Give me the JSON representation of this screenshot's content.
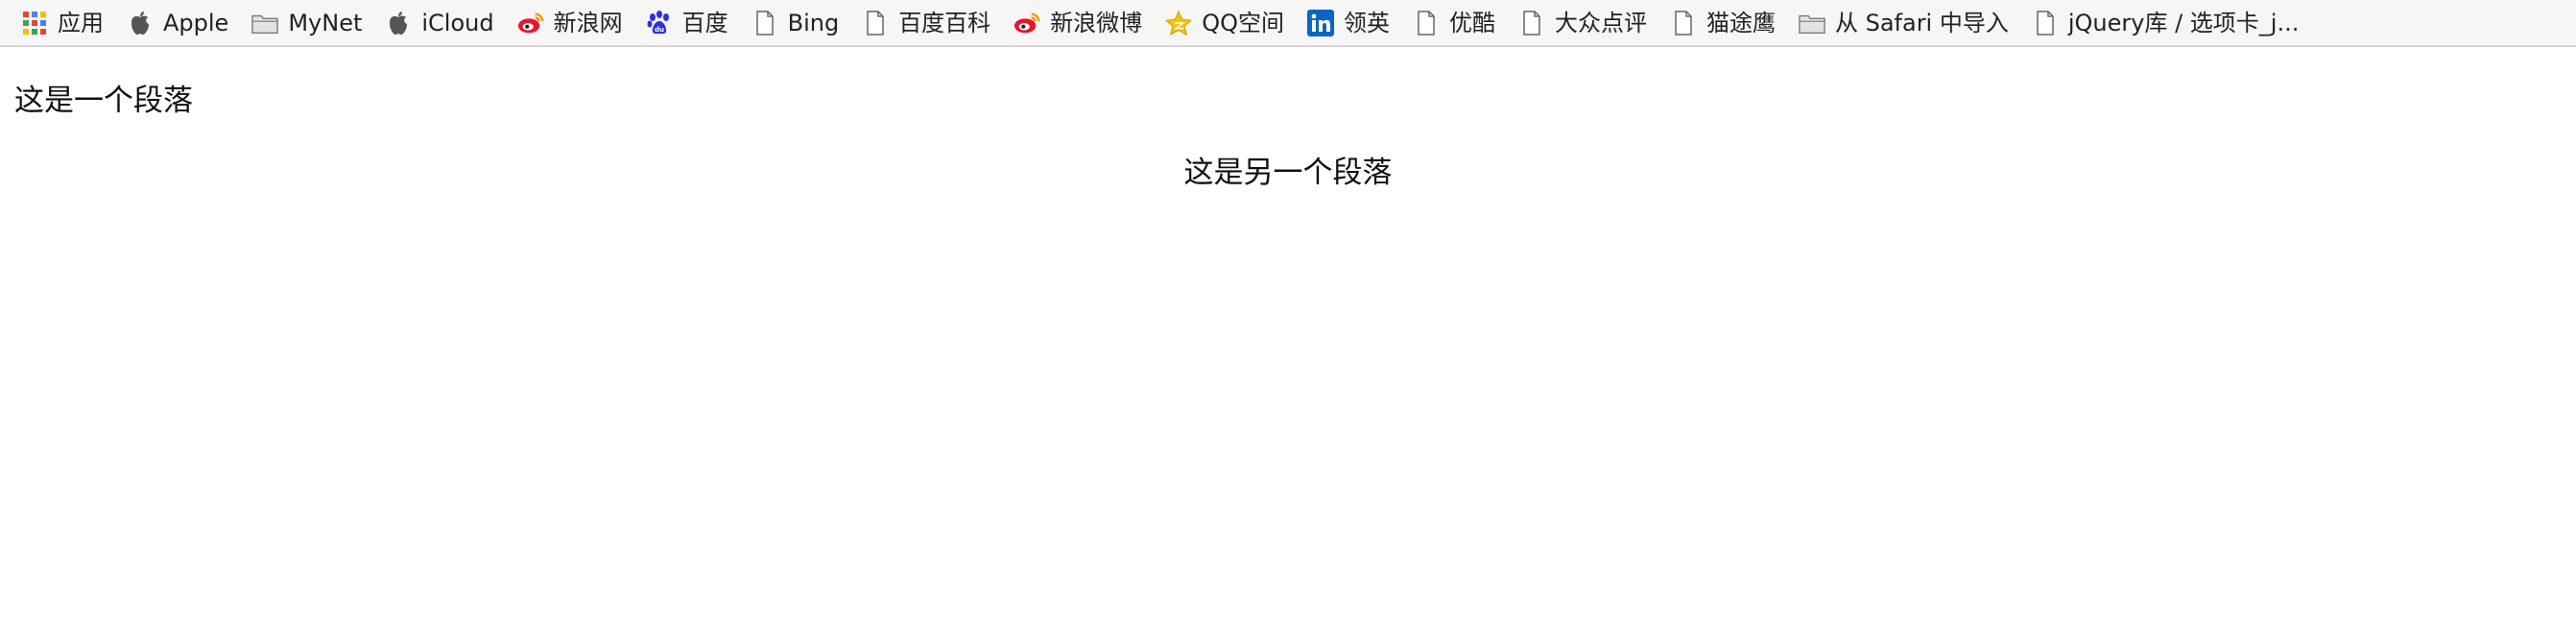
{
  "bookmarks": [
    {
      "label": "应用",
      "icon": "apps-grid-icon"
    },
    {
      "label": "Apple",
      "icon": "apple-icon"
    },
    {
      "label": "MyNet",
      "icon": "folder-icon"
    },
    {
      "label": "iCloud",
      "icon": "apple-icon"
    },
    {
      "label": "新浪网",
      "icon": "weibo-icon"
    },
    {
      "label": "百度",
      "icon": "baidu-paw-icon"
    },
    {
      "label": "Bing",
      "icon": "page-icon"
    },
    {
      "label": "百度百科",
      "icon": "page-icon"
    },
    {
      "label": "新浪微博",
      "icon": "weibo-icon"
    },
    {
      "label": "QQ空间",
      "icon": "star-icon"
    },
    {
      "label": "领英",
      "icon": "linkedin-icon"
    },
    {
      "label": "优酷",
      "icon": "page-icon"
    },
    {
      "label": "大众点评",
      "icon": "page-icon"
    },
    {
      "label": "猫途鹰",
      "icon": "page-icon"
    },
    {
      "label": "从 Safari 中导入",
      "icon": "folder-icon"
    },
    {
      "label": "jQuery库 / 选项卡_j...",
      "icon": "page-icon"
    }
  ],
  "content": {
    "paragraph_1": "这是一个段落",
    "paragraph_2": "这是另一个段落"
  },
  "colors": {
    "bar_bg": "#f6f6f6",
    "weibo_red": "#e6162d",
    "baidu_blue": "#2932e1",
    "linkedin_blue": "#0a66c2",
    "star_yellow": "#f5c400"
  }
}
